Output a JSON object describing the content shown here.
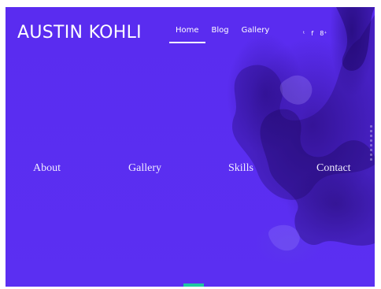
{
  "header": {
    "brand": "AUSTIN KOHLI",
    "nav": [
      {
        "label": "Home",
        "active": true
      },
      {
        "label": "Blog",
        "active": false
      },
      {
        "label": "Gallery",
        "active": false
      }
    ],
    "social": [
      {
        "icon": "twitter-icon",
        "glyph": "🐦"
      },
      {
        "icon": "facebook-icon",
        "glyph": "f"
      },
      {
        "icon": "google-plus-icon",
        "glyph": "8⁺"
      }
    ]
  },
  "sections": [
    {
      "label": "About"
    },
    {
      "label": "Gallery"
    },
    {
      "label": "Skills"
    },
    {
      "label": "Contact"
    }
  ],
  "colors": {
    "background": "#5b2ff2",
    "accent": "#1ec8a0",
    "text": "#ffffff"
  }
}
